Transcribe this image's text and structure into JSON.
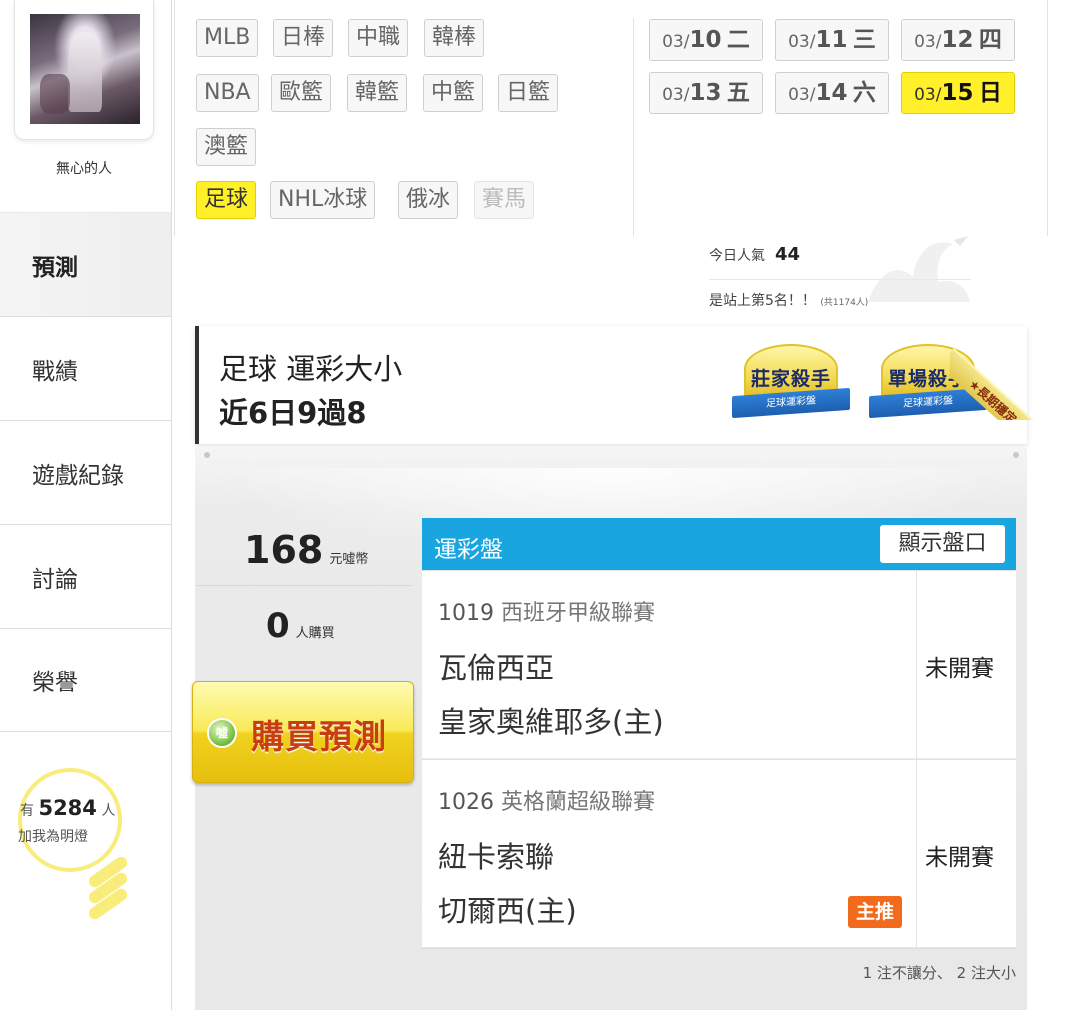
{
  "profile": {
    "username": "無心的人"
  },
  "sidebar": {
    "items": [
      {
        "label": "預測",
        "active": true
      },
      {
        "label": "戰績"
      },
      {
        "label": "遊戲紀錄"
      },
      {
        "label": "討論"
      },
      {
        "label": "榮譽"
      }
    ],
    "fans": {
      "prefix": "有",
      "count": "5284",
      "suffix": "人",
      "caption": "加我為明燈"
    }
  },
  "sports": {
    "row1": [
      "MLB",
      "日棒",
      "中職",
      "韓棒"
    ],
    "row2": [
      "NBA",
      "歐籃",
      "韓籃",
      "中籃",
      "日籃"
    ],
    "row3": [
      "澳籃"
    ],
    "row4": [
      {
        "label": "足球",
        "selected": true
      },
      {
        "label": "NHL冰球"
      },
      {
        "label": "俄冰"
      },
      {
        "label": "賽馬",
        "disabled": true
      }
    ]
  },
  "dates": [
    {
      "md": "03/",
      "day": "10",
      "weekday": "二"
    },
    {
      "md": "03/",
      "day": "11",
      "weekday": "三"
    },
    {
      "md": "03/",
      "day": "12",
      "weekday": "四"
    },
    {
      "md": "03/",
      "day": "13",
      "weekday": "五"
    },
    {
      "md": "03/",
      "day": "14",
      "weekday": "六"
    },
    {
      "md": "03/",
      "day": "15",
      "weekday": "日",
      "selected": true
    }
  ],
  "popularity": {
    "label": "今日人氣",
    "value": "44",
    "rank_text": "是站上第5名！！",
    "rank_total": "(共1174人)"
  },
  "banner": {
    "title": "足球 運彩大小",
    "record": "近6日9過8",
    "badges": [
      {
        "name": "莊家殺手",
        "ribbon": "足球運彩盤"
      },
      {
        "name": "單場殺手",
        "ribbon": "足球運彩盤"
      }
    ],
    "corner": "★長期穩定★"
  },
  "purchase": {
    "price": "168",
    "price_unit": "元噓幣",
    "buyers": "0",
    "buyers_unit": "人購買",
    "button": "購買預測",
    "coin": "噓"
  },
  "table": {
    "title": "運彩盤",
    "show_odds": "顯示盤口",
    "games": [
      {
        "code": "1019",
        "league": "西班牙甲級聯賽",
        "away": "瓦倫西亞",
        "home": "皇家奧維耶多(主)",
        "status": "未開賽",
        "main_pick": ""
      },
      {
        "code": "1026",
        "league": "英格蘭超級聯賽",
        "away": "紐卡索聯",
        "home": "切爾西(主)",
        "status": "未開賽",
        "main_pick": "主推"
      }
    ],
    "note": "1 注不讓分、 2 注大小"
  },
  "colors": {
    "selected": "#fff02a",
    "table_header": "#19a5e0",
    "main_pick": "#f26a1b",
    "buy_text": "#c73e10"
  }
}
